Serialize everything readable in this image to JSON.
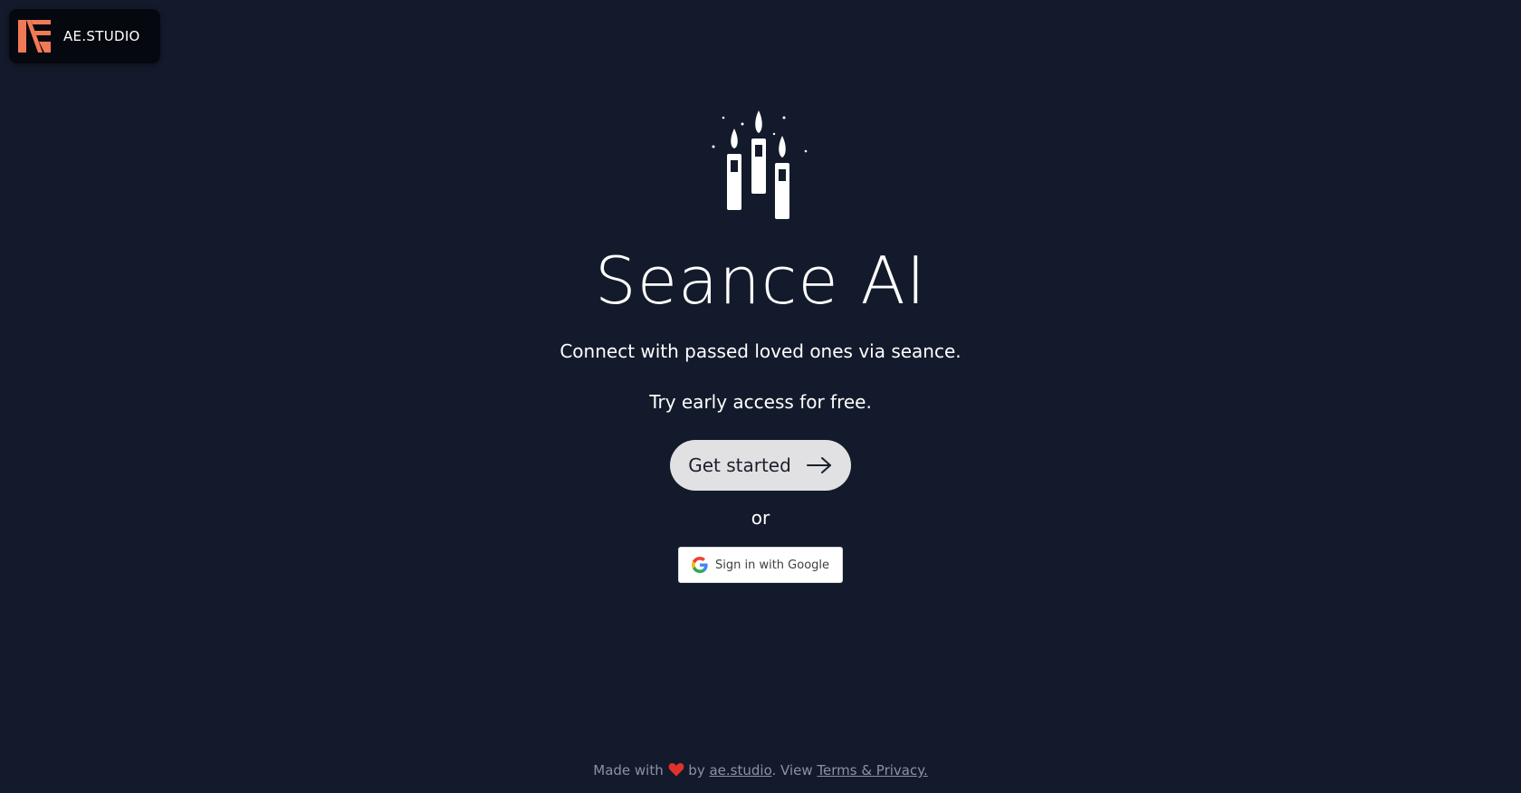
{
  "brand": {
    "name": "AE.STUDIO",
    "logo_icon": "ae-studio-logo-icon",
    "logo_color": "#f07a55"
  },
  "hero": {
    "icon": "candles-icon",
    "title": "Seance AI",
    "subtitle": "Connect with passed loved ones via seance.",
    "tagline": "Try early access for free."
  },
  "cta": {
    "label": "Get started",
    "icon": "arrow-right-icon"
  },
  "divider_text": "or",
  "google": {
    "label": "Sign in with Google",
    "icon": "google-g-icon"
  },
  "footer": {
    "made_with": "Made with",
    "heart_icon": "heart-icon",
    "by": "by",
    "studio_link": "ae.studio",
    "view": ". View",
    "terms_link": "Terms & Privacy."
  },
  "colors": {
    "background": "#131a2b",
    "cta_background": "#e1e1e3",
    "footer_text": "#8b92a3",
    "heart": "#e0312b"
  }
}
